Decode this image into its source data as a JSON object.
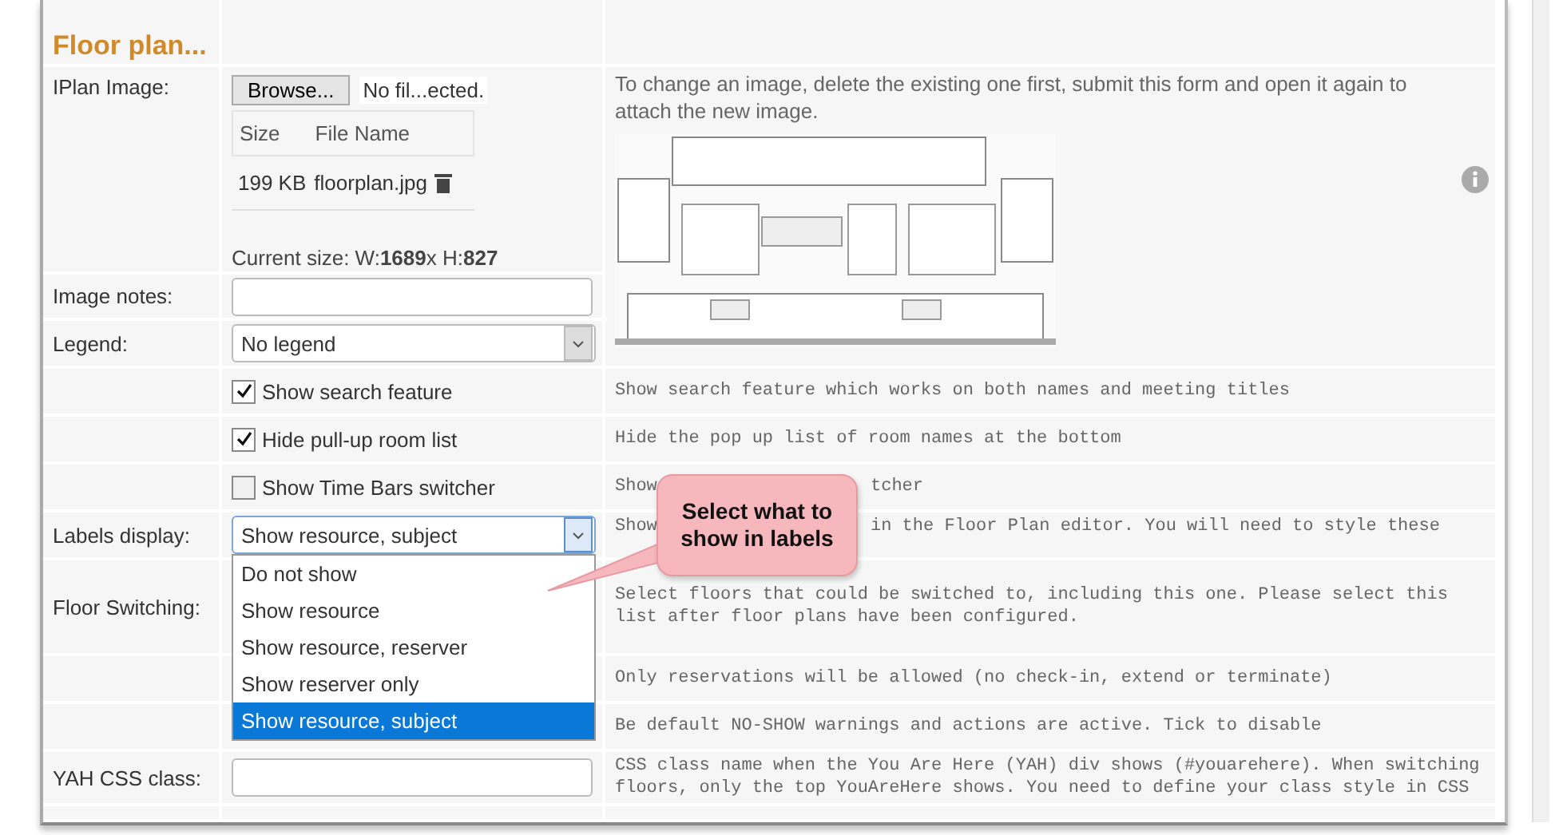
{
  "section_title": "Floor plan...",
  "image_row": {
    "label": "IPlan Image:",
    "browse_button": "Browse...",
    "file_status": "No fil...ected.",
    "columns": [
      "Size",
      "File Name"
    ],
    "file": {
      "size": "199 KB",
      "name": "floorplan.jpg"
    },
    "current_size": "Current size: W:**1689**x H:**827**",
    "description": "To change an image, delete the existing one first, submit this form and open it again to attach the new image."
  },
  "rows": [
    {
      "kind": "text",
      "label": "Image notes:"
    },
    {
      "kind": "select",
      "label": "Legend:",
      "value": "No legend",
      "open": false
    },
    {
      "kind": "checkbox",
      "text": "Show search feature",
      "checked": true,
      "description": [
        "Show search feature which works on both names and meeting titles"
      ]
    },
    {
      "kind": "checkbox",
      "text": "Hide pull-up room list",
      "checked": true,
      "description": [
        "Hide the pop up list of room names at the bottom"
      ]
    },
    {
      "kind": "checkbox",
      "text": "Show Time Bars switcher",
      "checked": false,
      "description": [
        "Show",
        "tcher"
      ]
    },
    {
      "kind": "select",
      "label": "Labels display:",
      "value": "Show resource, subject",
      "open": true,
      "description": [
        "Show",
        "in the Floor Plan editor. You will need to style these"
      ]
    },
    {
      "kind": "covered",
      "label": "Floor Switching:",
      "description": [
        "Select floors that could be switched to, including this one. Please select this list after floor plans have been configured."
      ]
    },
    {
      "kind": "covered",
      "description": [
        "Only reservations will be allowed (no check-in, extend or terminate)"
      ]
    },
    {
      "kind": "covered",
      "description": [
        "Be default NO-SHOW warnings and actions are active. Tick to disable"
      ]
    },
    {
      "kind": "text",
      "label": "YAH CSS class:",
      "description": [
        "CSS class name when the You Are Here (YAH) div shows (#youarehere).  When switching floors, only the top YouAreHere shows. You need to define your class style in CSS"
      ]
    }
  ],
  "dropdown": {
    "options": [
      {
        "label": "Do not show",
        "selected": false
      },
      {
        "label": "Show resource",
        "selected": false
      },
      {
        "label": "Show resource, reserver",
        "selected": false
      },
      {
        "label": "Show reserver only",
        "selected": false
      },
      {
        "label": "Show resource, subject",
        "selected": true
      }
    ]
  },
  "callout": {
    "text": "Select what to show in labels"
  }
}
